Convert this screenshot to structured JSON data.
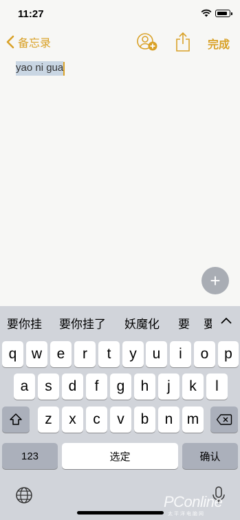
{
  "status_bar": {
    "time": "11:27"
  },
  "nav": {
    "back_label": "备忘录",
    "done_label": "完成"
  },
  "note": {
    "text": "yao ni gua"
  },
  "fab": {
    "label": "+"
  },
  "keyboard": {
    "candidates": [
      "要你挂",
      "要你挂了",
      "妖魔化",
      "要",
      "要"
    ],
    "row1": [
      "q",
      "w",
      "e",
      "r",
      "t",
      "y",
      "u",
      "i",
      "o",
      "p"
    ],
    "row2": [
      "a",
      "s",
      "d",
      "f",
      "g",
      "h",
      "j",
      "k",
      "l"
    ],
    "row3": [
      "z",
      "x",
      "c",
      "v",
      "b",
      "n",
      "m"
    ],
    "numbers_label": "123",
    "space_label": "选定",
    "return_label": "确认"
  },
  "watermark": {
    "brand": "PConline",
    "sub": "太平洋电脑网"
  },
  "colors": {
    "accent": "#d9a127",
    "keyboard_bg": "#d1d4da",
    "selection": "#c9d6e3"
  }
}
